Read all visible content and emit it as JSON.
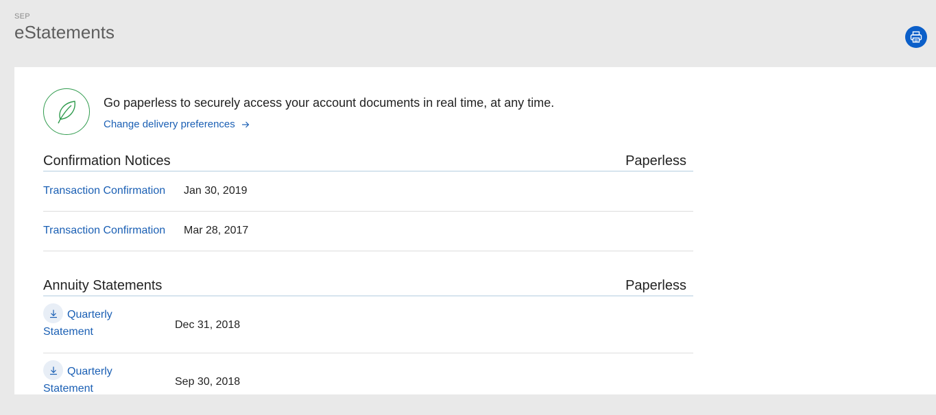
{
  "header": {
    "account_label": "SEP",
    "title": "eStatements"
  },
  "toolbar": {
    "print_icon": "printer-icon"
  },
  "promo": {
    "icon": "leaf-icon",
    "message": "Go paperless to securely access your account documents in real time, at any time.",
    "link_label": "Change delivery preferences",
    "link_icon": "arrow-right-icon"
  },
  "confirmation_notices": {
    "title": "Confirmation Notices",
    "column_right": "Paperless",
    "rows": [
      {
        "label": "Transaction Confirmation",
        "date": "Jan 30, 2019"
      },
      {
        "label": "Transaction Confirmation",
        "date": "Mar 28, 2017"
      }
    ]
  },
  "annuity_statements": {
    "title": "Annuity Statements",
    "column_right": "Paperless",
    "rows": [
      {
        "label": "Quarterly Statement",
        "date": "Dec 31, 2018",
        "icon": "download-icon"
      },
      {
        "label": "Quarterly Statement",
        "date": "Sep 30, 2018",
        "icon": "download-icon"
      }
    ]
  },
  "colors": {
    "accent": "#0b5fc9",
    "link": "#1a5fb4",
    "leaf": "#2e9a4c",
    "background": "#e9e9e9"
  }
}
